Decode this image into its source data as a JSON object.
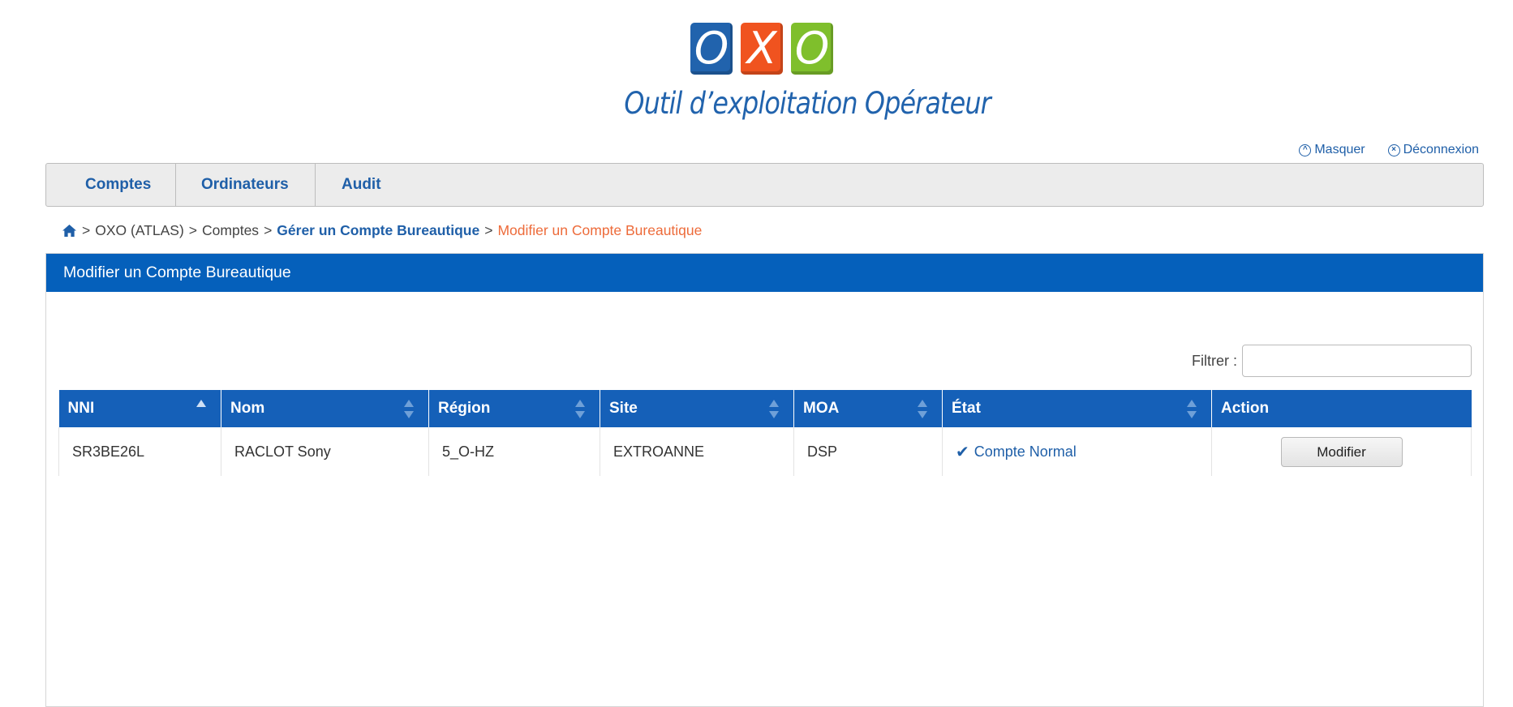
{
  "logo": {
    "letters": [
      "O",
      "X",
      "O"
    ],
    "tagline": "Outil d’exploitation Opérateur",
    "colors": {
      "o1": "#2163ad",
      "x": "#f0531f",
      "o2": "#7fbf2c"
    }
  },
  "toplinks": {
    "hide_label": "Masquer",
    "logout_label": "Déconnexion"
  },
  "nav": {
    "items": [
      {
        "label": "Comptes"
      },
      {
        "label": "Ordinateurs"
      },
      {
        "label": "Audit"
      }
    ]
  },
  "breadcrumb": {
    "sep": ">",
    "items": [
      "OXO (ATLAS)",
      "Comptes",
      "Gérer un Compte Bureautique",
      "Modifier un Compte Bureautique"
    ]
  },
  "panel": {
    "title": "Modifier un Compte Bureautique",
    "filter_label": "Filtrer :"
  },
  "table": {
    "columns": [
      "NNI",
      "Nom",
      "Région",
      "Site",
      "MOA",
      "État",
      "Action"
    ],
    "rows": [
      {
        "nni": "SR3BE26L",
        "nom": "RACLOT Sony",
        "region": "5_O-HZ",
        "site": "EXTROANNE",
        "moa": "DSP",
        "etat": "Compte Normal",
        "action": "Modifier"
      }
    ]
  },
  "colors": {
    "primary": "#0560bb",
    "link": "#1f5fa8",
    "breadcrumb_current": "#ed6b3a"
  }
}
